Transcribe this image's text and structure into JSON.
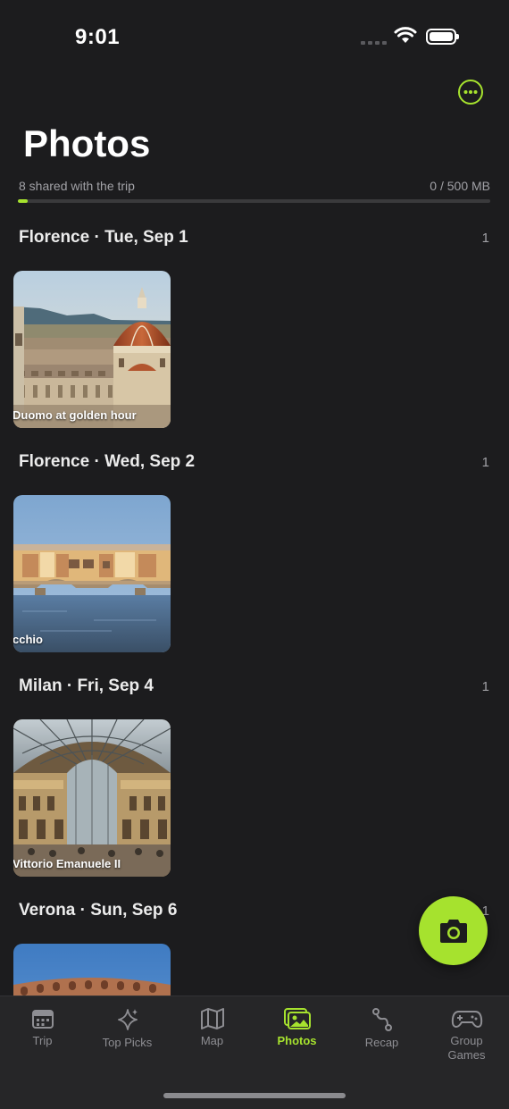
{
  "status_bar": {
    "time": "9:01"
  },
  "header": {
    "title": "Photos",
    "storage_caption": "8 shared with the trip",
    "storage_usage": "0 / 500 MB",
    "storage_progress_fraction": 0.02
  },
  "sections": [
    {
      "title": "Florence · Tue, Sep 1",
      "count": "1",
      "photo_caption": "Duomo at golden hour",
      "photo_icon": "florence-duomo-photo"
    },
    {
      "title": "Florence · Wed, Sep 2",
      "count": "1",
      "photo_caption": "cchio",
      "photo_icon": "ponte-vecchio-photo"
    },
    {
      "title": "Milan · Fri, Sep 4",
      "count": "1",
      "photo_caption": "Vittorio Emanuele II",
      "photo_icon": "galleria-photo"
    },
    {
      "title": "Verona · Sun, Sep 6",
      "count": "1",
      "photo_caption": "",
      "photo_icon": "verona-arena-photo"
    }
  ],
  "fab": {
    "icon": "camera-icon"
  },
  "tabs": [
    {
      "label": "Trip",
      "icon": "calendar-icon"
    },
    {
      "label": "Top Picks",
      "icon": "sparkle-icon"
    },
    {
      "label": "Map",
      "icon": "map-icon"
    },
    {
      "label": "Photos",
      "icon": "photos-icon",
      "active": true
    },
    {
      "label": "Recap",
      "icon": "route-icon"
    },
    {
      "label": "Group\nGames",
      "icon": "gamepad-icon"
    }
  ],
  "colors": {
    "accent": "#a6e22e",
    "background": "#1c1c1e",
    "tab_bar": "#262628",
    "muted_text": "#a1a1a6"
  }
}
